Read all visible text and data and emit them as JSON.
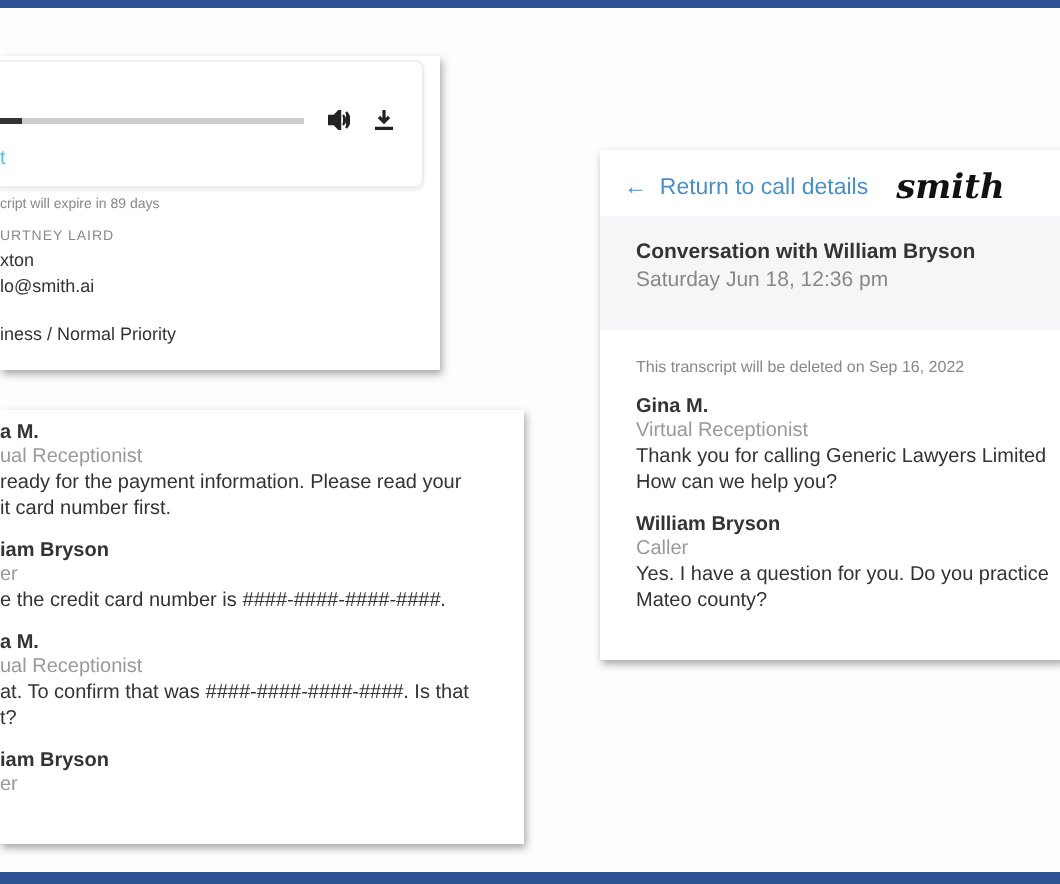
{
  "details_card": {
    "player": {
      "level": 0.07,
      "link": "t"
    },
    "expiry_note": "cript will expire in 89 days",
    "agent_label": "URTNEY LAIRD",
    "lines": [
      "xton",
      "lo@smith.ai"
    ],
    "priority": "iness / Normal Priority"
  },
  "transcript_card": {
    "messages": [
      {
        "speaker": "a M.",
        "role": "ual Receptionist",
        "text": "ready for the payment information. Please read your\nit card number first."
      },
      {
        "speaker": "iam Bryson",
        "role": "er",
        "text": "e the credit card number is *####-####-####-####*."
      },
      {
        "speaker": "a M.",
        "role": "ual Receptionist",
        "text": "at. To confirm that was *####-####-####-####*. Is that\nt?"
      },
      {
        "speaker": "iam Bryson",
        "role": "er"
      }
    ]
  },
  "conversation_card": {
    "back_link": "Return to call details",
    "back_arrow": "←",
    "logo": "smith",
    "title": "Conversation with William Bryson",
    "date": "Saturday Jun 18, 12:36 pm",
    "deletion_note": "This transcript will be deleted on Sep 16, 2022",
    "messages": [
      {
        "speaker": "Gina M.",
        "role": "Virtual Receptionist",
        "text": "Thank you for calling Generic Lawyers Limited\nHow can we help you?"
      },
      {
        "speaker": "William Bryson",
        "role": "Caller",
        "text": "Yes. I have a question for you. Do you practice\nMateo county?"
      }
    ]
  }
}
